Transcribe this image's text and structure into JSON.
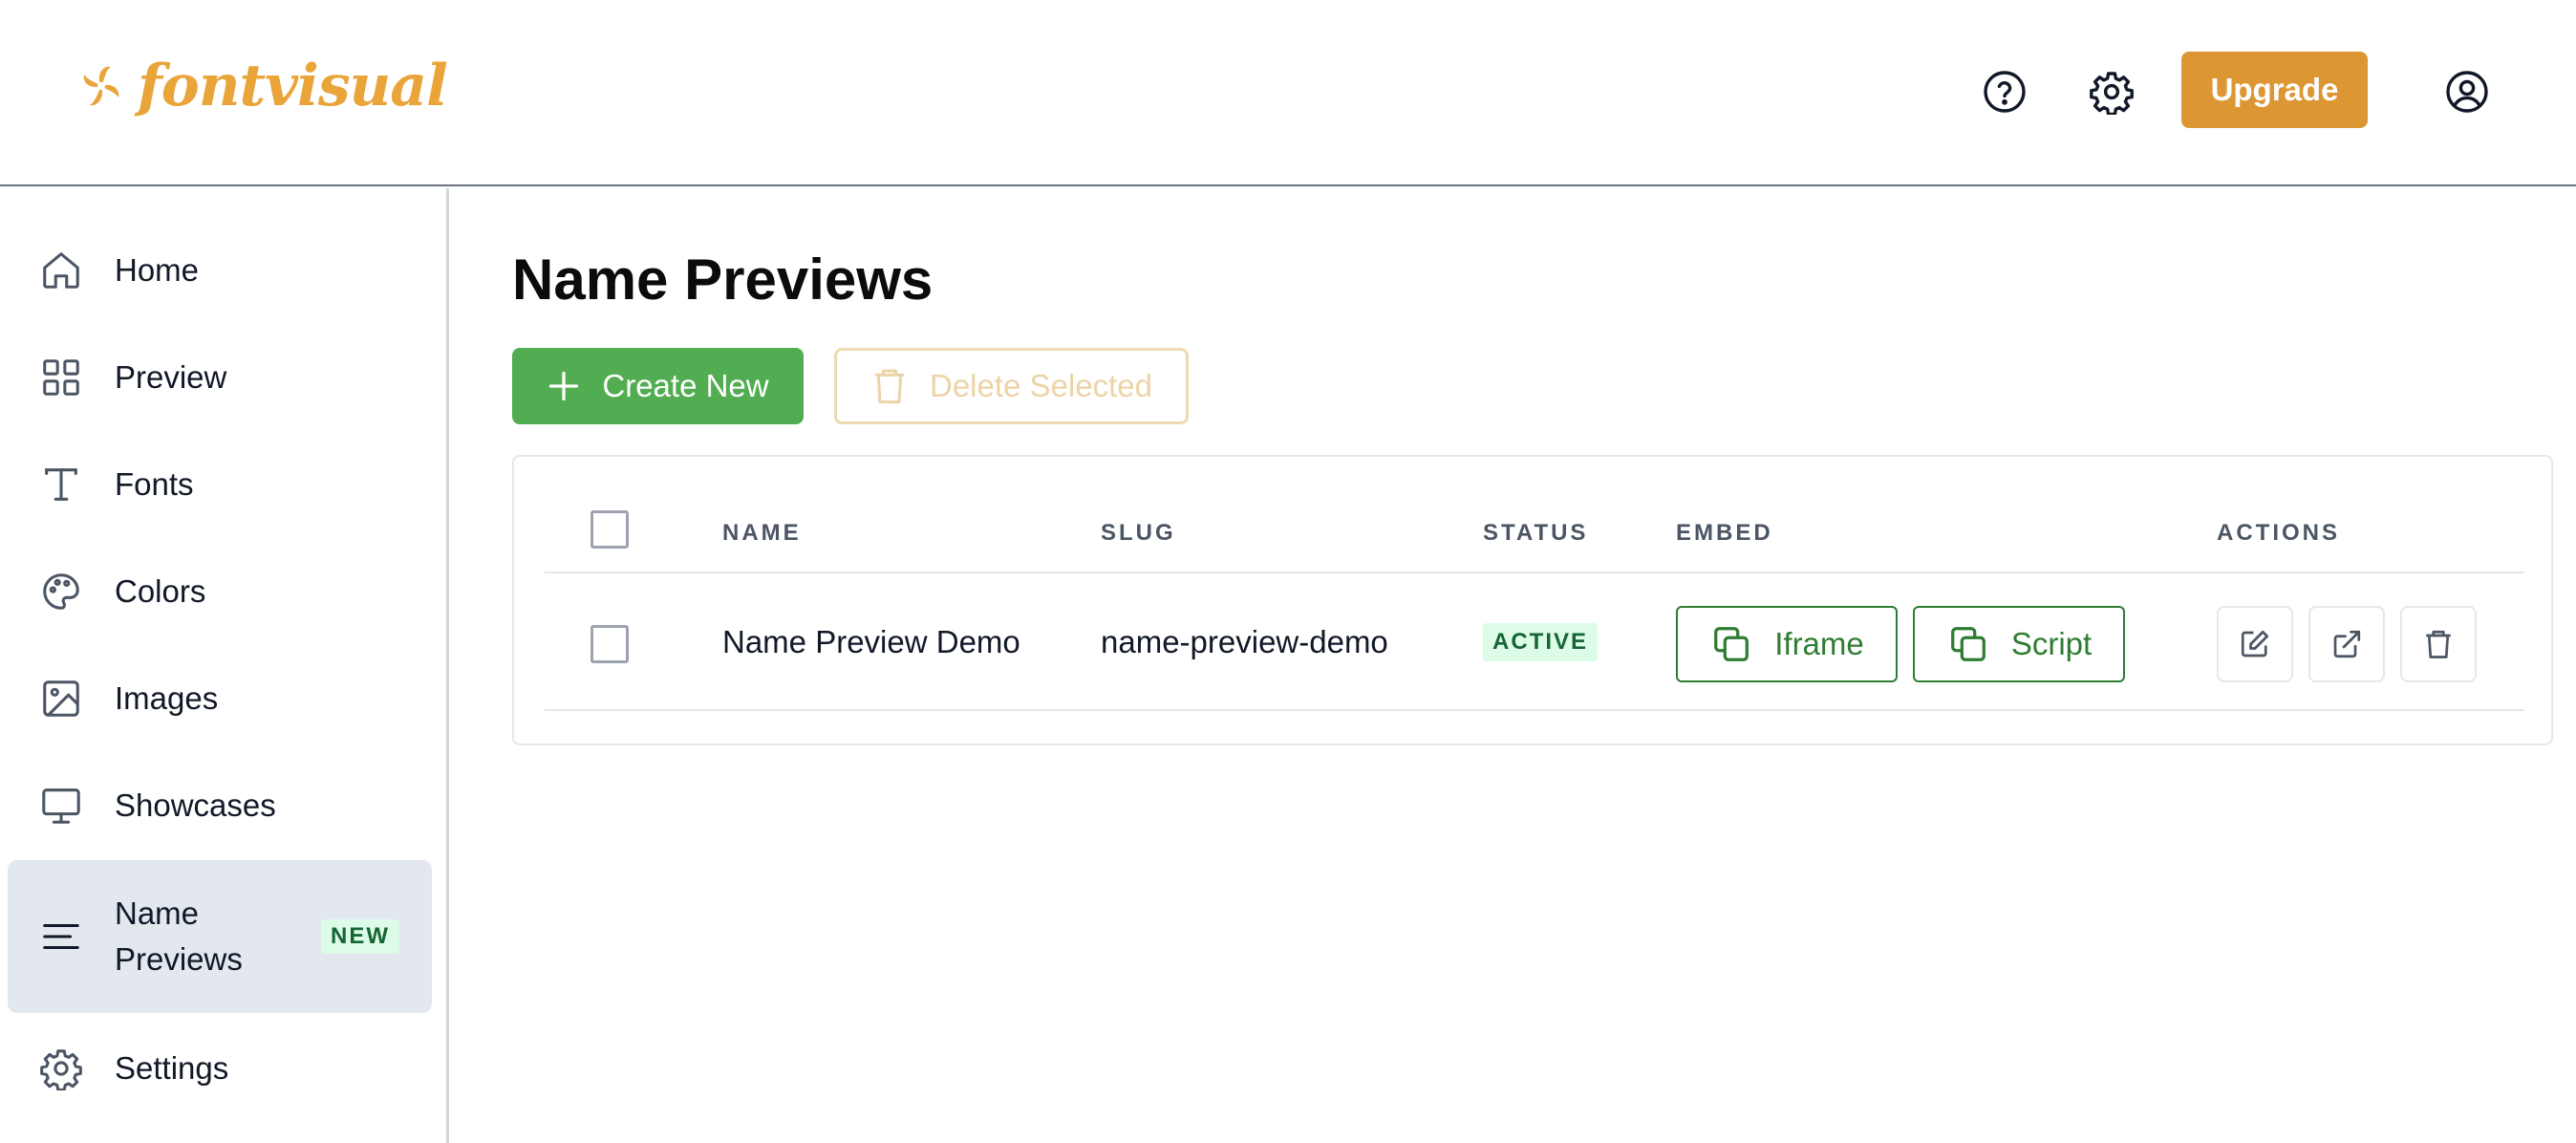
{
  "header": {
    "logo_text": "fontvisual",
    "help_icon": "help-circle-icon",
    "settings_icon": "gear-icon",
    "upgrade_label": "Upgrade",
    "account_icon": "user-circle-icon",
    "brand_color": "#e9a53a",
    "upgrade_color": "#dc9734"
  },
  "sidebar": {
    "items": [
      {
        "label": "Home",
        "icon": "home-icon"
      },
      {
        "label": "Preview",
        "icon": "grid-icon"
      },
      {
        "label": "Fonts",
        "icon": "type-icon"
      },
      {
        "label": "Colors",
        "icon": "palette-icon"
      },
      {
        "label": "Images",
        "icon": "image-icon"
      },
      {
        "label": "Showcases",
        "icon": "monitor-icon"
      },
      {
        "label": "Name Previews",
        "icon": "lines-icon",
        "badge": "NEW",
        "active": true
      },
      {
        "label": "Settings",
        "icon": "gear-icon"
      }
    ]
  },
  "main": {
    "title": "Name Previews",
    "create_label": "Create New",
    "delete_selected_label": "Delete Selected",
    "table": {
      "columns": [
        "NAME",
        "SLUG",
        "STATUS",
        "EMBED",
        "ACTIONS"
      ],
      "rows": [
        {
          "name": "Name Preview Demo",
          "slug": "name-preview-demo",
          "status": "ACTIVE",
          "embed_iframe": "Iframe",
          "embed_script": "Script",
          "actions": [
            "edit-icon",
            "external-link-icon",
            "trash-icon"
          ]
        }
      ]
    }
  },
  "colors": {
    "create_green": "#52ad52",
    "embed_green": "#2f7d32",
    "active_badge_bg": "#dcfce7",
    "active_nav_bg": "#e3e8ef"
  }
}
